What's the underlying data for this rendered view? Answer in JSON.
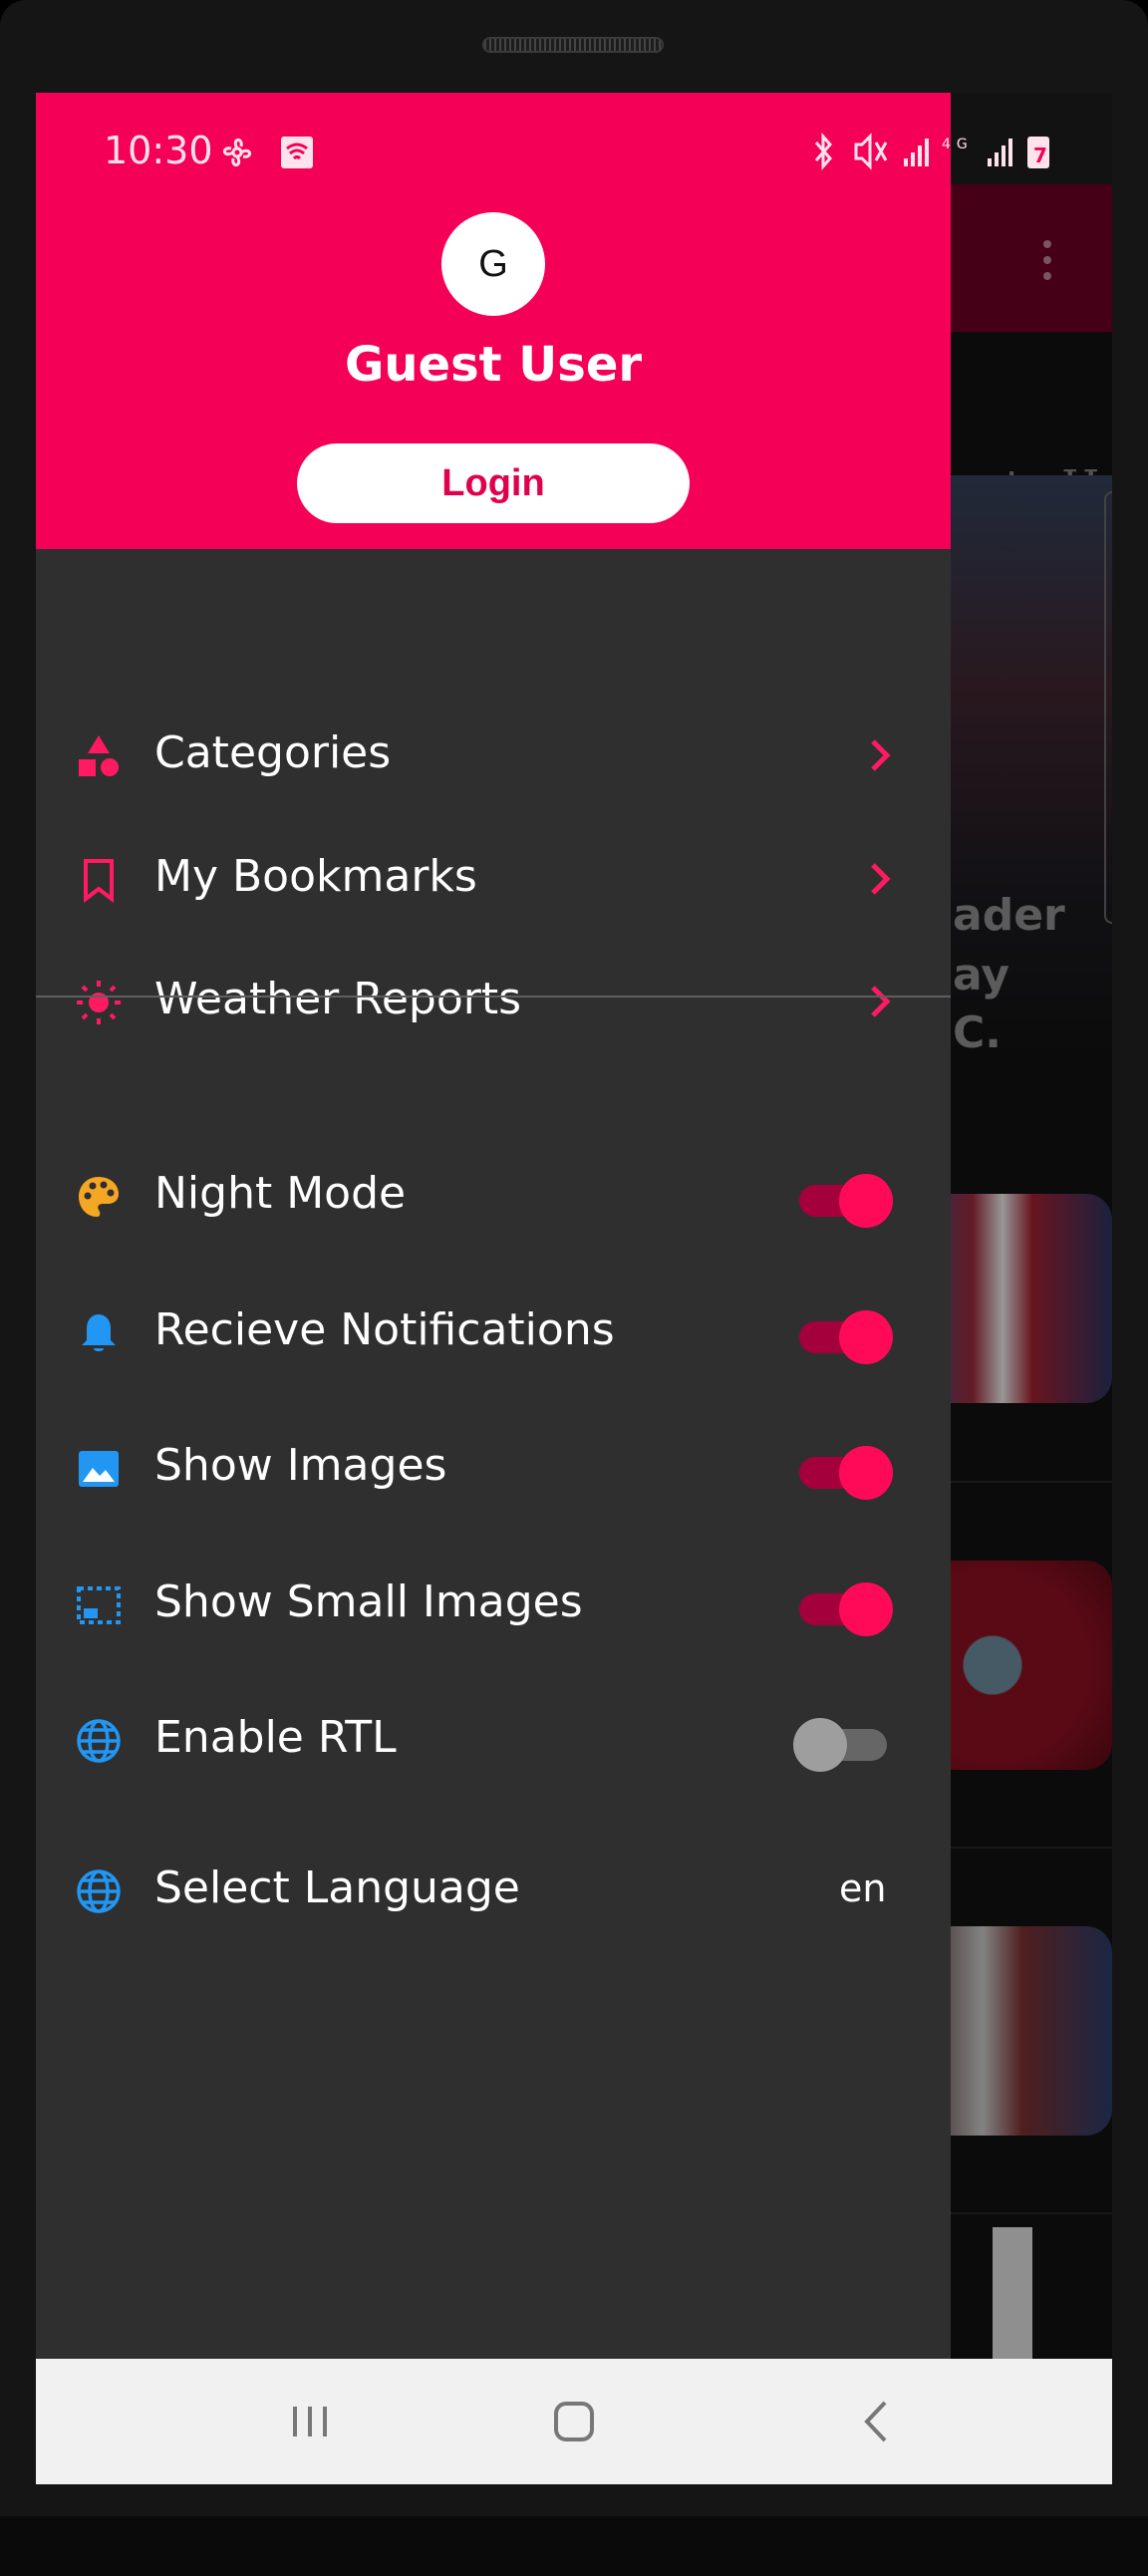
{
  "status_bar": {
    "time": "10:30",
    "left_icons": [
      "fan-icon",
      "wifi-icon"
    ],
    "right_icons": [
      "bluetooth-icon",
      "mute-icon",
      "signal-icon",
      "4g-icon",
      "signal-icon",
      "battery-icon"
    ],
    "battery_text": "7"
  },
  "background_app": {
    "tabs": [
      "ent",
      "He"
    ],
    "hero_text": [
      "ader",
      "ay",
      "C."
    ]
  },
  "drawer": {
    "avatar_initial": "G",
    "user_name": "Guest User",
    "login_label": "Login",
    "nav_items": [
      {
        "label": "Categories",
        "icon": "category-shapes-icon"
      },
      {
        "label": "My Bookmarks",
        "icon": "bookmark-icon"
      },
      {
        "label": "Weather Reports",
        "icon": "sun-icon"
      }
    ],
    "settings": [
      {
        "label": "Night Mode",
        "icon": "palette-icon",
        "on": true
      },
      {
        "label": "Recieve Notifications",
        "icon": "bell-icon",
        "on": true
      },
      {
        "label": "Show Images",
        "icon": "image-icon",
        "on": true
      },
      {
        "label": "Show Small Images",
        "icon": "small-image-icon",
        "on": true
      },
      {
        "label": "Enable RTL",
        "icon": "globe-icon",
        "on": false
      }
    ],
    "language": {
      "label": "Select Language",
      "icon": "globe-icon",
      "value": "en"
    }
  },
  "colors": {
    "accent": "#f50057",
    "drawer_bg": "#2f2f2f",
    "toggle_on": "#ff0a59",
    "palette_icon": "#f5a623",
    "blue_icon": "#2196f3"
  },
  "nav_bar": [
    "recent-apps-icon",
    "home-icon",
    "back-icon"
  ]
}
